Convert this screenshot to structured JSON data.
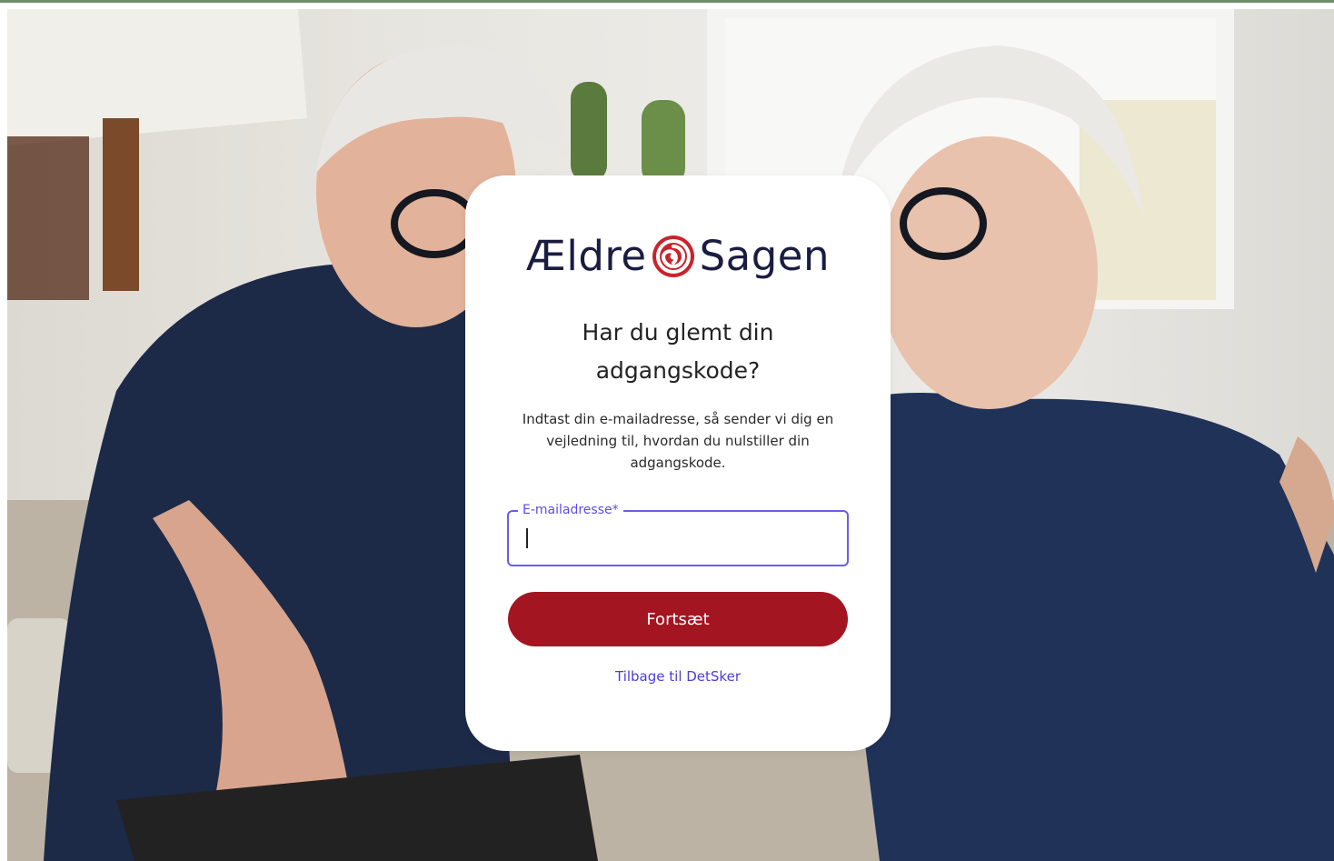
{
  "brand": {
    "name_left": "Ældre",
    "name_right": "Sagen"
  },
  "title": "Har du glemt din adgangskode?",
  "description": "Indtast din e-mailadresse, så sender vi dig en vejledning til, hvordan du nulstiller din adgangskode.",
  "email_field": {
    "label": "E-mailadresse*",
    "value": ""
  },
  "continue_button": "Fortsæt",
  "back_link": "Tilbage til DetSker",
  "colors": {
    "accent_red": "#a31520",
    "focus_purple": "#6a5de8",
    "link_blue": "#4b3fd6",
    "logo_navy": "#1a1c40"
  }
}
